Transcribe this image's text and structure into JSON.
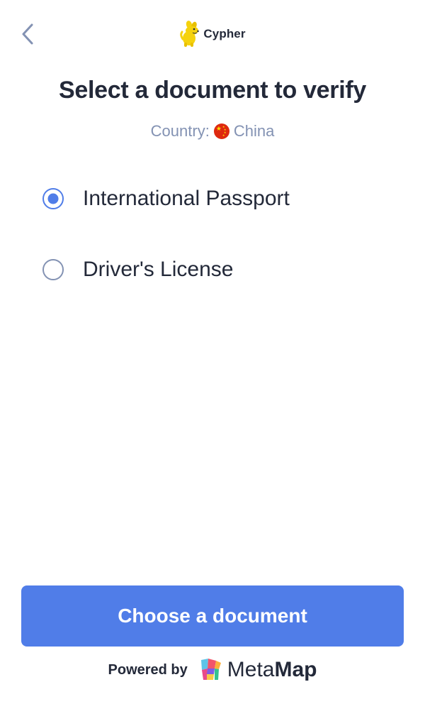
{
  "header": {
    "brand_name": "Cypher"
  },
  "page": {
    "title": "Select a document to verify",
    "country_label": "Country:",
    "country_value": "China",
    "country_flag_icon": "china-flag-icon"
  },
  "options": [
    {
      "label": "International Passport",
      "selected": true
    },
    {
      "label": "Driver's License",
      "selected": false
    }
  ],
  "cta": {
    "label": "Choose a document"
  },
  "footer": {
    "powered_by": "Powered by",
    "brand_light": "Meta",
    "brand_bold": "Map"
  },
  "colors": {
    "accent": "#507de8",
    "text": "#232939",
    "muted": "#8392b3"
  }
}
